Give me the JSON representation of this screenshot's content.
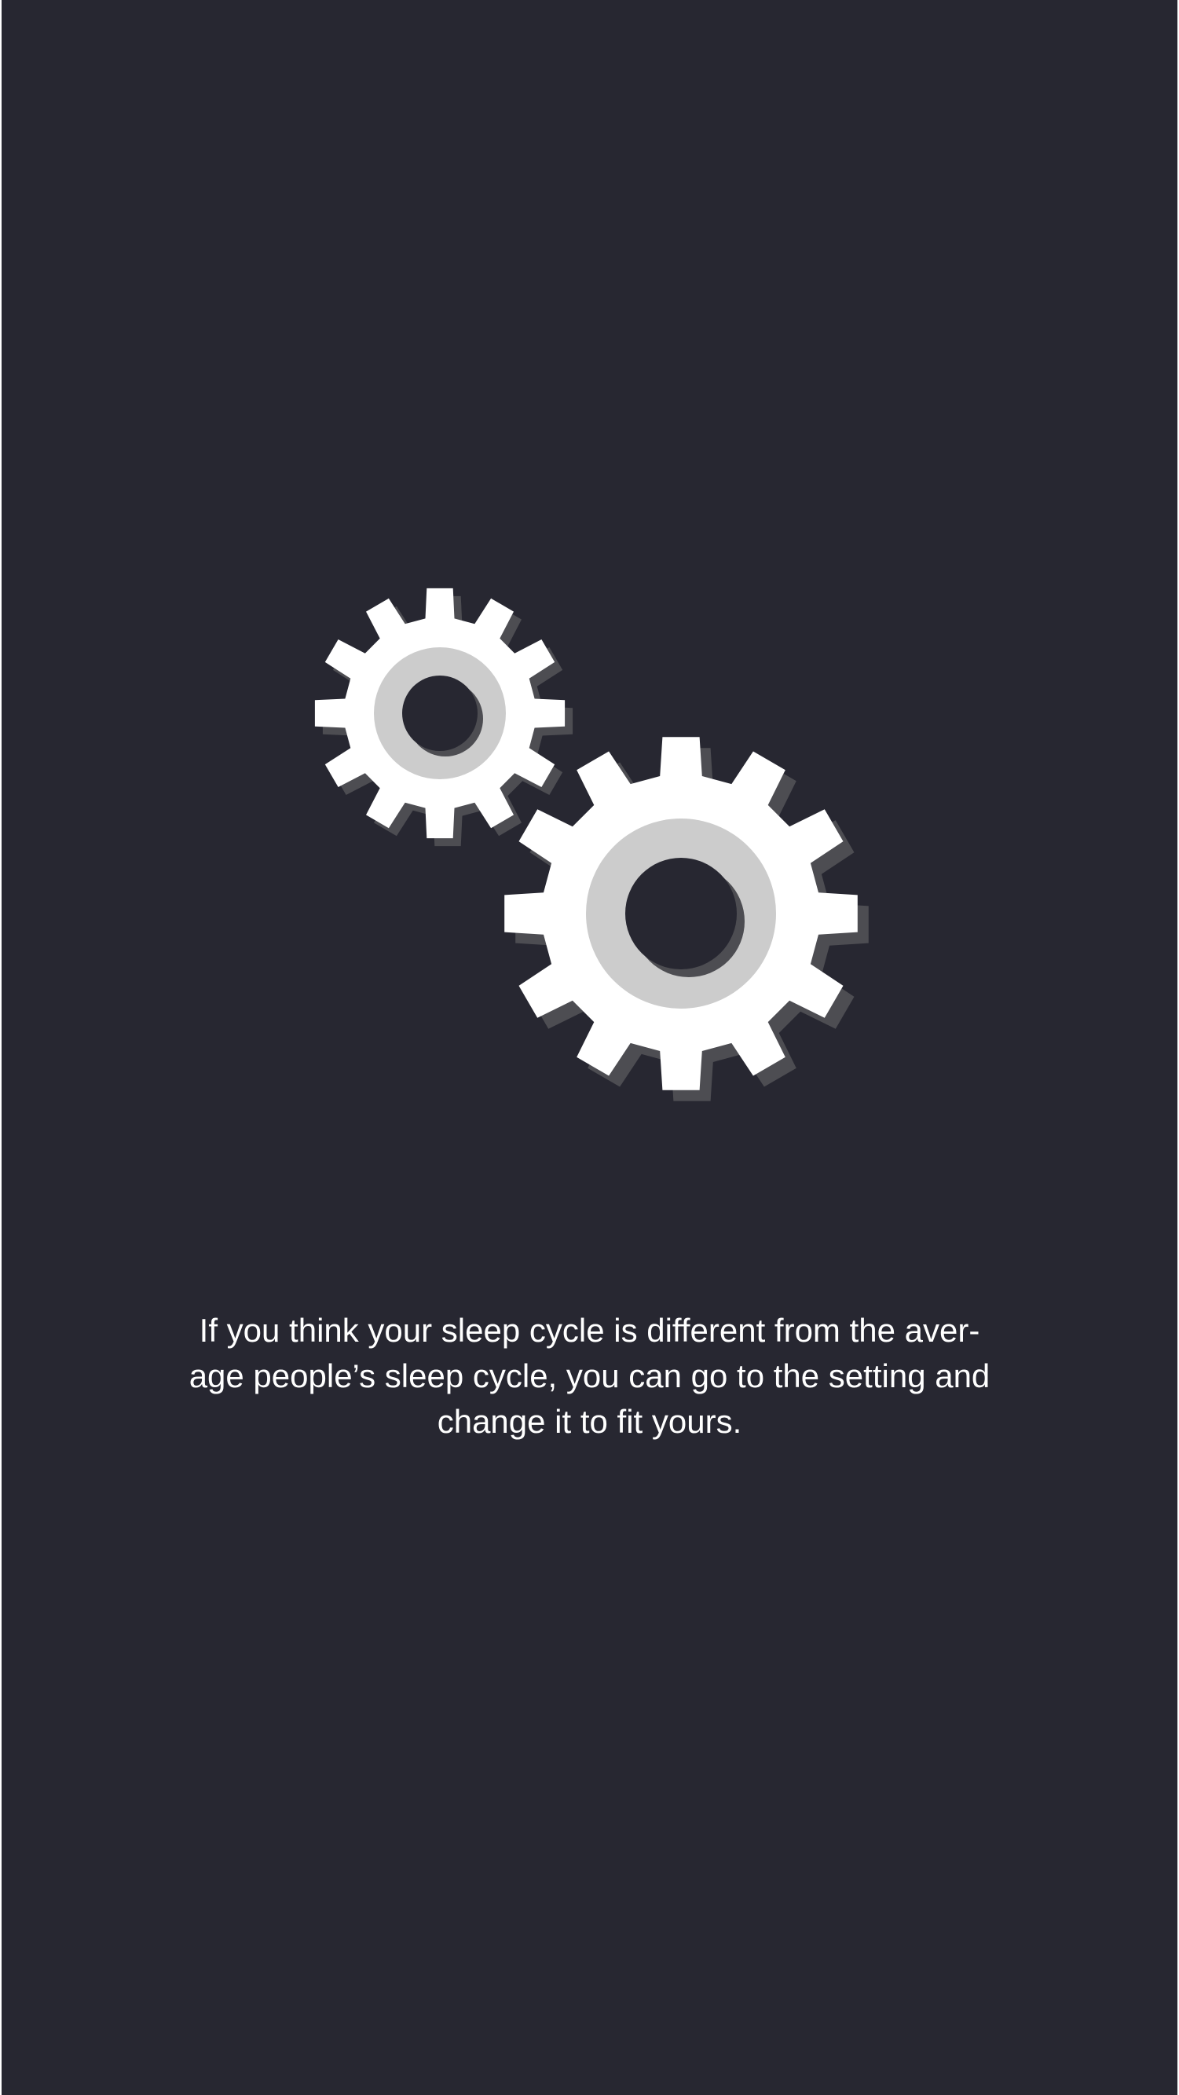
{
  "screen": {
    "background_color": "#272731",
    "illustration": {
      "icon": "gears-icon",
      "gear_color": "#ffffff",
      "hub_color": "#cccccc",
      "shadow_color": "#4d4d52"
    },
    "message_lines": [
      "If you think your sleep cycle is different from the aver-",
      "age people’s sleep cycle, you can go to the setting and",
      "change it to fit yours."
    ]
  }
}
